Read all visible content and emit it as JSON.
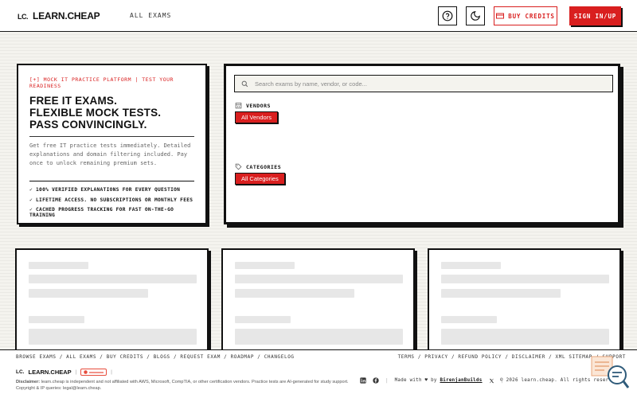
{
  "header": {
    "logo_mark": "LC.",
    "logo_text": "LEARN.CHEAP",
    "nav_all_exams": "ALL EXAMS",
    "help_icon": "help-circle-icon",
    "theme_icon": "moon-icon",
    "buy_credits": "BUY CREDITS",
    "sign_in": "SIGN IN/UP"
  },
  "hero": {
    "tag": "[+] MOCK IT PRACTICE PLATFORM | TEST YOUR READINESS",
    "title_lines": [
      "FREE IT EXAMS.",
      "FLEXIBLE MOCK TESTS.",
      "PASS CONVINCINGLY."
    ],
    "description": "Get free IT practice tests immediately. Detailed explanations and domain filtering included. Pay once to unlock remaining premium sets.",
    "features": [
      "100% VERIFIED EXPLANATIONS FOR EVERY QUESTION",
      "LIFETIME ACCESS. NO SUBSCRIPTIONS OR MONTHLY FEES",
      "CACHED PROGRESS TRACKING FOR FAST ON-THE-GO TRAINING"
    ],
    "check": "✓"
  },
  "filter": {
    "search_placeholder": "Search exams by name, vendor, or code...",
    "vendors_label": "VENDORS",
    "vendors_chip": "All Vendors",
    "categories_label": "CATEGORIES",
    "categories_chip": "All Categories"
  },
  "footer": {
    "links_left": "BROWSE EXAMS / ALL EXAMS / BUY CREDITS / BLOGS / REQUEST EXAM / ROADMAP / CHANGELOG",
    "links_right": "TERMS / PRIVACY / REFUND POLICY / DISCLAIMER / XML SITEMAP / SUPPORT",
    "logo_mark": "LC.",
    "logo_text": "LEARN.CHEAP",
    "disclaimer_label": "Disclaimer:",
    "disclaimer": "learn.cheap is independent and not affiliated with AWS, Microsoft, CompTIA, or other certification vendors. Practice tests are AI-generated for study support. Copyright & IP queries: legal@learn.cheap.",
    "made_with": "Made with ♥ by",
    "author": "BirenjanBuilds",
    "copyright": "© 2026 learn.cheap. All rights reserved."
  },
  "colors": {
    "accent": "#d91f1f",
    "ink": "#111111",
    "paper": "#f4f3ee"
  }
}
